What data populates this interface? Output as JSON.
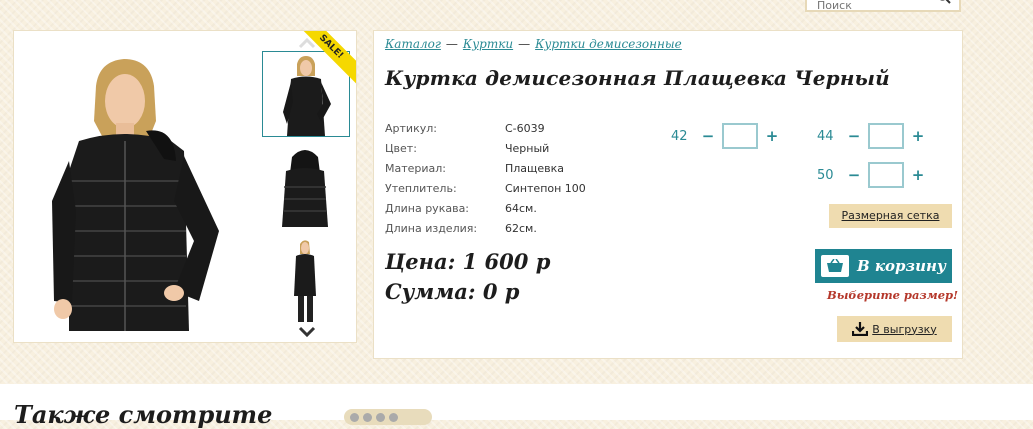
{
  "search": {
    "placeholder": "Поиск"
  },
  "gallery": {
    "sale_badge": "SALE!"
  },
  "breadcrumbs": [
    "Каталог",
    "Куртки",
    "Куртки демисезонные"
  ],
  "breadcrumb_separator": "—",
  "product": {
    "title": "Куртка демисезонная Плащевка Черный",
    "properties": [
      {
        "key": "Артикул:",
        "value": "С-6039"
      },
      {
        "key": "Цвет:",
        "value": "Черный"
      },
      {
        "key": "Материал:",
        "value": "Плащевка"
      },
      {
        "key": "Утеплитель:",
        "value": "Синтепон 100"
      },
      {
        "key": "Длина рукава:",
        "value": "64см."
      },
      {
        "key": "Длина изделия:",
        "value": "62см."
      }
    ],
    "price": "Цена: 1 600 р",
    "sum": "Сумма: 0 р"
  },
  "sizes": [
    {
      "size": "42",
      "qty": ""
    },
    {
      "size": "44",
      "qty": ""
    },
    {
      "size": "50",
      "qty": ""
    }
  ],
  "buttons": {
    "minus": "−",
    "plus": "+",
    "size_chart": "Размерная сетка",
    "add_to_cart": "В корзину",
    "export": "В выгрузку"
  },
  "warning": "Выберите размер!",
  "also_title": "Также смотрите",
  "colors": {
    "accent": "#1f8491",
    "warning": "#b5382b",
    "beige_button": "#efdcb0"
  }
}
